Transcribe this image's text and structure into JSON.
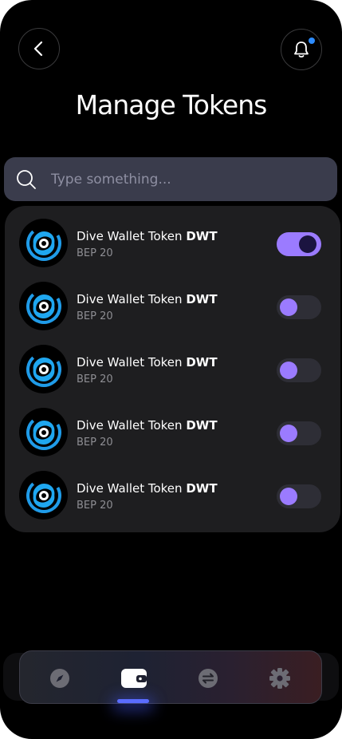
{
  "header": {
    "title": "Manage Tokens",
    "back_icon": "chevron-left-icon",
    "notification_icon": "bell-icon",
    "notification_dot_color": "#2d8cff"
  },
  "search": {
    "placeholder": "Type something...",
    "icon": "search-icon"
  },
  "tokens": [
    {
      "name": "Dive Wallet Token",
      "symbol": "DWT",
      "chain": "BEP 20",
      "enabled": true
    },
    {
      "name": "Dive Wallet Token",
      "symbol": "DWT",
      "chain": "BEP 20",
      "enabled": false
    },
    {
      "name": "Dive Wallet Token",
      "symbol": "DWT",
      "chain": "BEP 20",
      "enabled": false
    },
    {
      "name": "Dive Wallet Token",
      "symbol": "DWT",
      "chain": "BEP 20",
      "enabled": false
    },
    {
      "name": "Dive Wallet Token",
      "symbol": "DWT",
      "chain": "BEP 20",
      "enabled": false
    }
  ],
  "tabbar": {
    "tabs": [
      {
        "icon": "compass-icon",
        "active": false
      },
      {
        "icon": "wallet-icon",
        "active": true
      },
      {
        "icon": "swap-icon",
        "active": false
      },
      {
        "icon": "gear-icon",
        "active": false
      }
    ]
  },
  "colors": {
    "accent": "#9b7bff",
    "background": "#000000",
    "card": "#1e1e20",
    "search_bg": "#3a3c4c",
    "tab_indicator": "#5a6cff"
  }
}
